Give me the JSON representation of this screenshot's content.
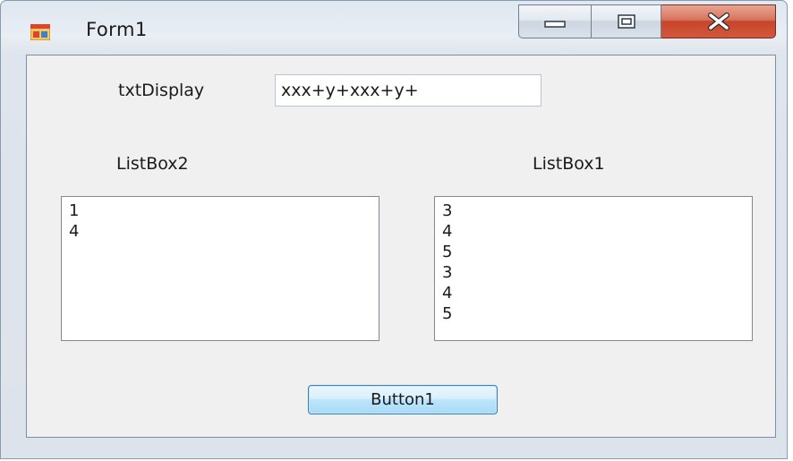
{
  "window": {
    "title": "Form1",
    "controls": {
      "minimize_icon": "minimize-icon",
      "maximize_icon": "maximize-icon",
      "close_icon": "close-icon"
    }
  },
  "form": {
    "display_label": "txtDisplay",
    "display_value": "xxx+y+xxx+y+",
    "listbox2_label": "ListBox2",
    "listbox1_label": "ListBox1",
    "listbox2_items": [
      "1",
      "4"
    ],
    "listbox1_items": [
      "3",
      "4",
      "5",
      "3",
      "4",
      "5"
    ],
    "button_label": "Button1"
  },
  "colors": {
    "close_button": "#c7442a",
    "button_border": "#3c7fb1",
    "client_background": "#f0f0f0"
  }
}
